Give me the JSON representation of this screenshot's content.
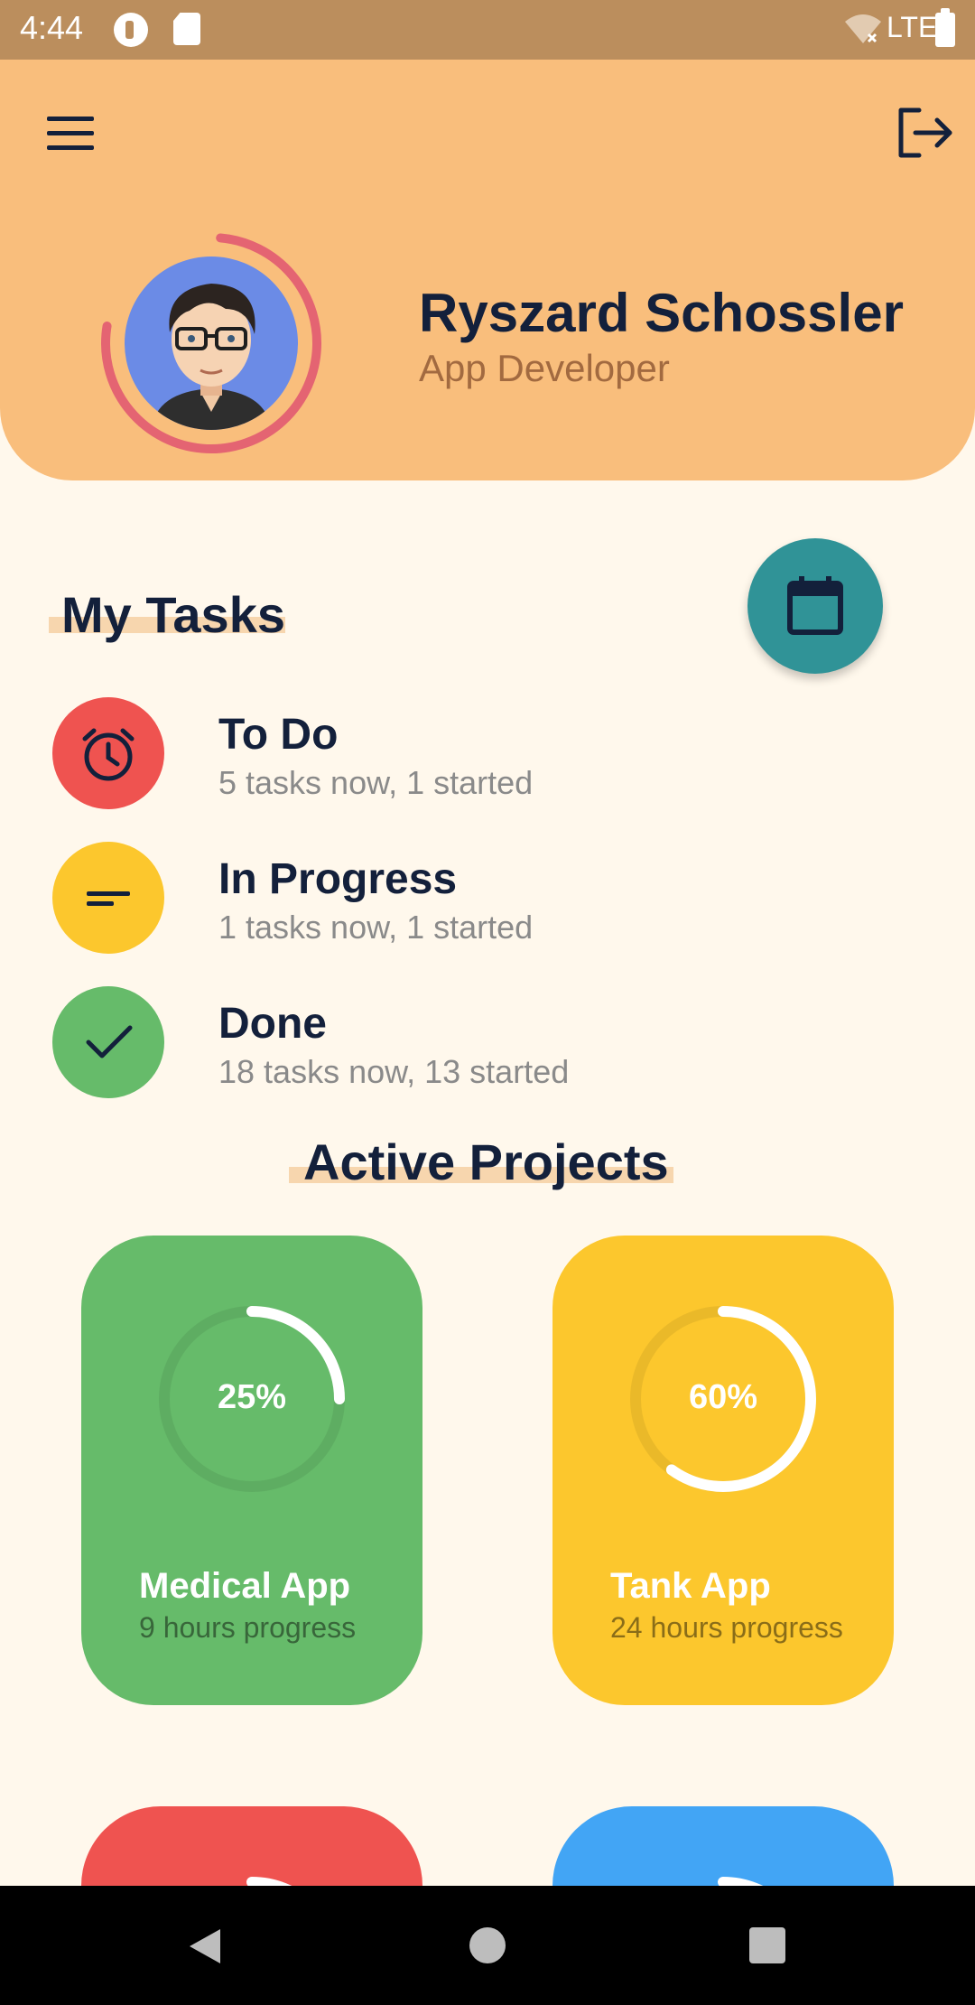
{
  "status_bar": {
    "time": "4:44",
    "network": "LTE"
  },
  "header": {
    "user_name": "Ryszard Schossler",
    "user_role": "App Developer"
  },
  "my_tasks": {
    "title": "My Tasks",
    "items": [
      {
        "title": "To Do",
        "subtitle": "5 tasks now, 1 started",
        "icon": "alarm-clock-icon",
        "color": "#EF5350"
      },
      {
        "title": "In Progress",
        "subtitle": "1 tasks now, 1 started",
        "icon": "short-text-icon",
        "color": "#FCC72D"
      },
      {
        "title": "Done",
        "subtitle": "18 tasks now, 13 started",
        "icon": "check-icon",
        "color": "#66BB6A"
      }
    ]
  },
  "active_projects": {
    "title": "Active Projects",
    "cards": [
      {
        "name": "Medical App",
        "progress_text": "9 hours progress",
        "percent_label": "25%",
        "progress": 0.25,
        "color": "#66BB6A"
      },
      {
        "name": "Tank App",
        "progress_text": "24 hours progress",
        "percent_label": "60%",
        "progress": 0.6,
        "color": "#FCC72D"
      },
      {
        "name": "",
        "progress_text": "",
        "percent_label": "",
        "progress": 0.25,
        "color": "#EF5350"
      },
      {
        "name": "",
        "progress_text": "",
        "percent_label": "",
        "progress": 0.25,
        "color": "#42A5F5"
      }
    ]
  },
  "colors": {
    "header_bg": "#F9BE7C",
    "page_bg": "#FFF8EC",
    "dark_blue": "#13203B",
    "calendar_button": "#309397",
    "avatar_ring": "#E46472"
  }
}
